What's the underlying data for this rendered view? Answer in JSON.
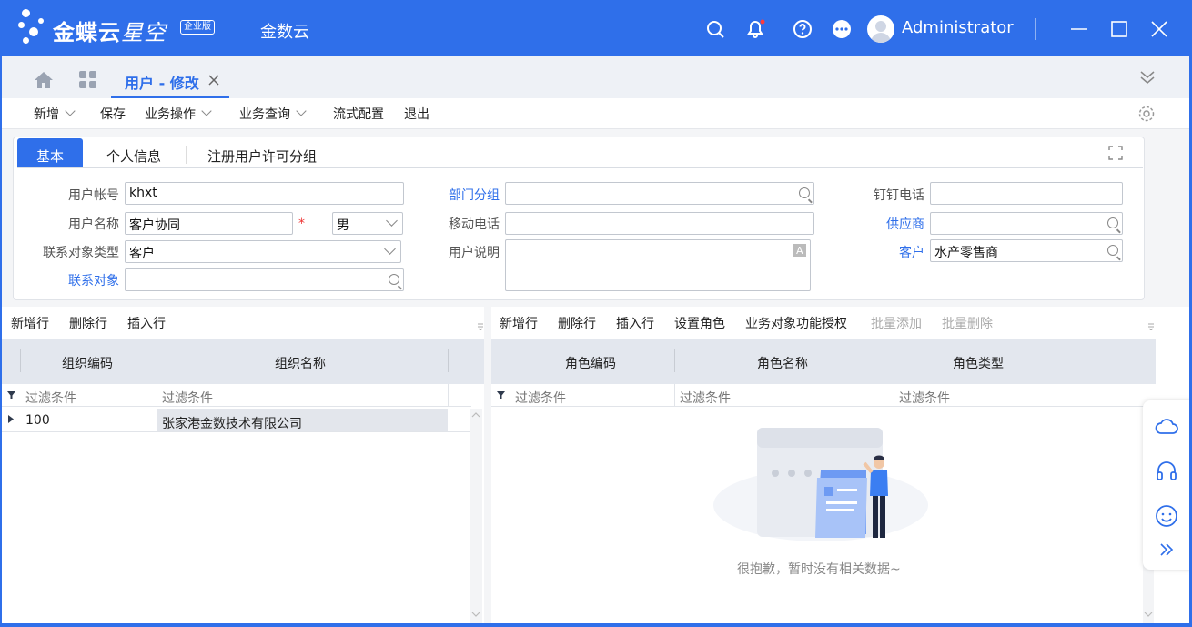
{
  "app": {
    "logo_text": "金蝶云",
    "logo_italic": "星空",
    "edition": "企业版",
    "product": "金数云",
    "user": "Administrator"
  },
  "tab": {
    "label": "用户 - 修改"
  },
  "toolbar": {
    "new": "新增",
    "save": "保存",
    "biz_ops": "业务操作",
    "biz_query": "业务查询",
    "flow_config": "流式配置",
    "exit": "退出"
  },
  "form_tabs": {
    "basic": "基本",
    "personal": "个人信息",
    "license": "注册用户许可分组"
  },
  "fields": {
    "user_account_label": "用户帐号",
    "user_account": "khxt",
    "user_name_label": "用户名称",
    "user_name": "客户协同",
    "gender": "男",
    "contact_type_label": "联系对象类型",
    "contact_type": "客户",
    "contact_label": "联系对象",
    "contact": "",
    "dept_group_label": "部门分组",
    "dept_group": "",
    "mobile_label": "移动电话",
    "mobile": "",
    "desc_label": "用户说明",
    "desc": "",
    "dingtalk_label": "钉钉电话",
    "dingtalk": "",
    "supplier_label": "供应商",
    "supplier": "",
    "customer_label": "客户",
    "customer": "水产零售商"
  },
  "org_grid": {
    "toolbar": [
      "新增行",
      "删除行",
      "插入行"
    ],
    "columns": [
      "组织编码",
      "组织名称"
    ],
    "filter": "过滤条件",
    "rows": [
      {
        "code": "100",
        "name": "张家港金数技术有限公司"
      }
    ]
  },
  "role_grid": {
    "toolbar": [
      "新增行",
      "删除行",
      "插入行",
      "设置角色",
      "业务对象功能授权"
    ],
    "toolbar_disabled": [
      "批量添加",
      "批量删除"
    ],
    "columns": [
      "角色编码",
      "角色名称",
      "角色类型"
    ],
    "filter": "过滤条件",
    "empty_message": "很抱歉，暂时没有相关数据~"
  },
  "colors": {
    "primary": "#2f6fea",
    "required": "#e33333"
  }
}
